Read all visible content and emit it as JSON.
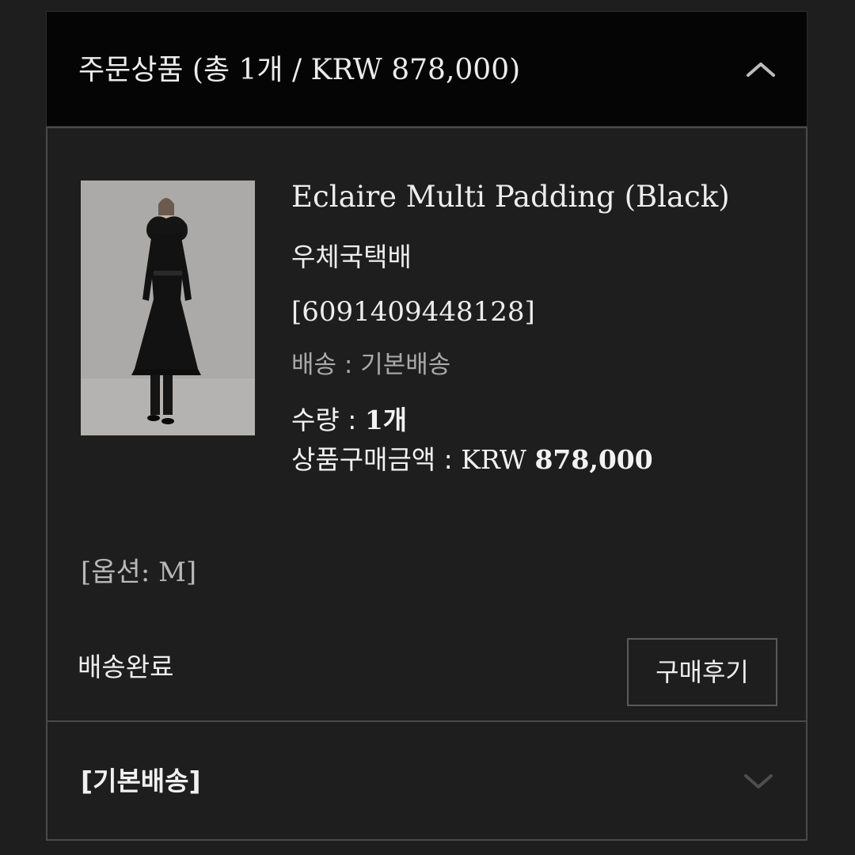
{
  "order_section": {
    "title": "주문상품 (총 1개 / KRW 878,000)",
    "toggle_icon": "chevron-up-icon"
  },
  "product": {
    "image_description": "product-photo",
    "name": "Eclaire Multi Padding (Black)",
    "carrier": "우체국택배",
    "tracking_number": "[6091409448128]",
    "shipping_type": "배송 : 기본배송",
    "quantity_label": "수량 : ",
    "quantity_value": "1개",
    "amount_label": "상품구매금액 : ",
    "amount_currency": "KRW ",
    "amount_value": "878,000",
    "option": "[옵션: M]",
    "status": "배송완료",
    "review_button_label": "구매후기"
  },
  "shipping_section": {
    "title": "[기본배송]",
    "toggle_icon": "chevron-down-icon"
  },
  "colors": {
    "background": "#1e1e1e",
    "header_background": "#050505",
    "border": "#4a4a4a",
    "muted_text": "#a9a9a9"
  }
}
